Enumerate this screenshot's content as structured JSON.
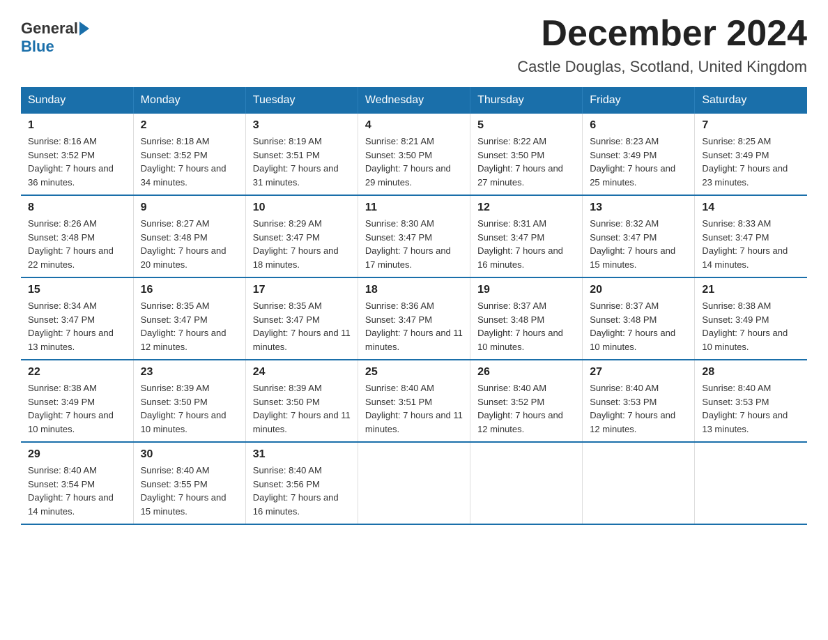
{
  "header": {
    "logo_general": "General",
    "logo_blue": "Blue",
    "title": "December 2024",
    "subtitle": "Castle Douglas, Scotland, United Kingdom"
  },
  "calendar": {
    "days_of_week": [
      "Sunday",
      "Monday",
      "Tuesday",
      "Wednesday",
      "Thursday",
      "Friday",
      "Saturday"
    ],
    "weeks": [
      [
        {
          "day": "1",
          "sunrise": "8:16 AM",
          "sunset": "3:52 PM",
          "daylight": "7 hours and 36 minutes."
        },
        {
          "day": "2",
          "sunrise": "8:18 AM",
          "sunset": "3:52 PM",
          "daylight": "7 hours and 34 minutes."
        },
        {
          "day": "3",
          "sunrise": "8:19 AM",
          "sunset": "3:51 PM",
          "daylight": "7 hours and 31 minutes."
        },
        {
          "day": "4",
          "sunrise": "8:21 AM",
          "sunset": "3:50 PM",
          "daylight": "7 hours and 29 minutes."
        },
        {
          "day": "5",
          "sunrise": "8:22 AM",
          "sunset": "3:50 PM",
          "daylight": "7 hours and 27 minutes."
        },
        {
          "day": "6",
          "sunrise": "8:23 AM",
          "sunset": "3:49 PM",
          "daylight": "7 hours and 25 minutes."
        },
        {
          "day": "7",
          "sunrise": "8:25 AM",
          "sunset": "3:49 PM",
          "daylight": "7 hours and 23 minutes."
        }
      ],
      [
        {
          "day": "8",
          "sunrise": "8:26 AM",
          "sunset": "3:48 PM",
          "daylight": "7 hours and 22 minutes."
        },
        {
          "day": "9",
          "sunrise": "8:27 AM",
          "sunset": "3:48 PM",
          "daylight": "7 hours and 20 minutes."
        },
        {
          "day": "10",
          "sunrise": "8:29 AM",
          "sunset": "3:47 PM",
          "daylight": "7 hours and 18 minutes."
        },
        {
          "day": "11",
          "sunrise": "8:30 AM",
          "sunset": "3:47 PM",
          "daylight": "7 hours and 17 minutes."
        },
        {
          "day": "12",
          "sunrise": "8:31 AM",
          "sunset": "3:47 PM",
          "daylight": "7 hours and 16 minutes."
        },
        {
          "day": "13",
          "sunrise": "8:32 AM",
          "sunset": "3:47 PM",
          "daylight": "7 hours and 15 minutes."
        },
        {
          "day": "14",
          "sunrise": "8:33 AM",
          "sunset": "3:47 PM",
          "daylight": "7 hours and 14 minutes."
        }
      ],
      [
        {
          "day": "15",
          "sunrise": "8:34 AM",
          "sunset": "3:47 PM",
          "daylight": "7 hours and 13 minutes."
        },
        {
          "day": "16",
          "sunrise": "8:35 AM",
          "sunset": "3:47 PM",
          "daylight": "7 hours and 12 minutes."
        },
        {
          "day": "17",
          "sunrise": "8:35 AM",
          "sunset": "3:47 PM",
          "daylight": "7 hours and 11 minutes."
        },
        {
          "day": "18",
          "sunrise": "8:36 AM",
          "sunset": "3:47 PM",
          "daylight": "7 hours and 11 minutes."
        },
        {
          "day": "19",
          "sunrise": "8:37 AM",
          "sunset": "3:48 PM",
          "daylight": "7 hours and 10 minutes."
        },
        {
          "day": "20",
          "sunrise": "8:37 AM",
          "sunset": "3:48 PM",
          "daylight": "7 hours and 10 minutes."
        },
        {
          "day": "21",
          "sunrise": "8:38 AM",
          "sunset": "3:49 PM",
          "daylight": "7 hours and 10 minutes."
        }
      ],
      [
        {
          "day": "22",
          "sunrise": "8:38 AM",
          "sunset": "3:49 PM",
          "daylight": "7 hours and 10 minutes."
        },
        {
          "day": "23",
          "sunrise": "8:39 AM",
          "sunset": "3:50 PM",
          "daylight": "7 hours and 10 minutes."
        },
        {
          "day": "24",
          "sunrise": "8:39 AM",
          "sunset": "3:50 PM",
          "daylight": "7 hours and 11 minutes."
        },
        {
          "day": "25",
          "sunrise": "8:40 AM",
          "sunset": "3:51 PM",
          "daylight": "7 hours and 11 minutes."
        },
        {
          "day": "26",
          "sunrise": "8:40 AM",
          "sunset": "3:52 PM",
          "daylight": "7 hours and 12 minutes."
        },
        {
          "day": "27",
          "sunrise": "8:40 AM",
          "sunset": "3:53 PM",
          "daylight": "7 hours and 12 minutes."
        },
        {
          "day": "28",
          "sunrise": "8:40 AM",
          "sunset": "3:53 PM",
          "daylight": "7 hours and 13 minutes."
        }
      ],
      [
        {
          "day": "29",
          "sunrise": "8:40 AM",
          "sunset": "3:54 PM",
          "daylight": "7 hours and 14 minutes."
        },
        {
          "day": "30",
          "sunrise": "8:40 AM",
          "sunset": "3:55 PM",
          "daylight": "7 hours and 15 minutes."
        },
        {
          "day": "31",
          "sunrise": "8:40 AM",
          "sunset": "3:56 PM",
          "daylight": "7 hours and 16 minutes."
        },
        null,
        null,
        null,
        null
      ]
    ]
  }
}
